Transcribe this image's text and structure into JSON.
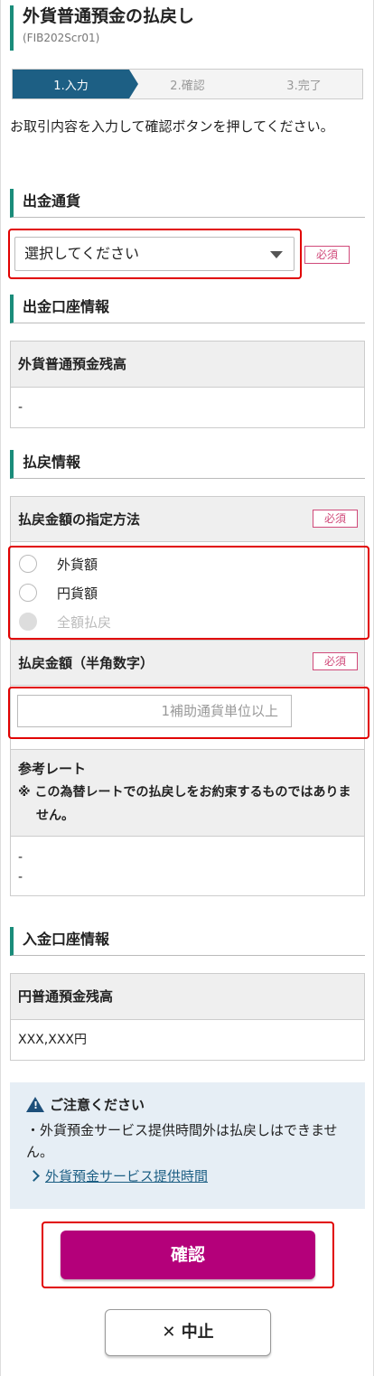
{
  "page": {
    "title": "外貨普通預金の払戻し",
    "screen_id": "(FIB202Scr01)"
  },
  "steps": [
    {
      "label": "1.入力",
      "active": true
    },
    {
      "label": "2.確認",
      "active": false
    },
    {
      "label": "3.完了",
      "active": false
    }
  ],
  "intro": "お取引内容を入力して確認ボタンを押してください。",
  "withdraw_currency": {
    "heading": "出金通貨",
    "select_value": "選択してください",
    "required": "必須"
  },
  "withdraw_account": {
    "heading": "出金口座情報",
    "balance_label": "外貨普通預金残高",
    "balance_value": "-"
  },
  "refund_info": {
    "heading": "払戻情報",
    "method_label": "払戻金額の指定方法",
    "method_required": "必須",
    "options": [
      "外貨額",
      "円貨額",
      "全額払戻"
    ],
    "amount_label": "払戻金額（半角数字）",
    "amount_required": "必須",
    "amount_placeholder": "1補助通貨単位以上",
    "rate_label": "参考レート",
    "rate_note": "※ この為替レートでの払戻しをお約束するものではありません。",
    "rate_value_1": "-",
    "rate_value_2": "-"
  },
  "deposit_account": {
    "heading": "入金口座情報",
    "balance_label": "円普通預金残高",
    "balance_value": "XXX,XXX円"
  },
  "notice": {
    "title": "ご注意ください",
    "body": "・外貨預金サービス提供時間外は払戻しはできません。",
    "link": "外貨預金サービス提供時間"
  },
  "buttons": {
    "confirm": "確認",
    "cancel": "中止"
  },
  "colors": {
    "accent": "#1a8c7a",
    "step_active": "#1d5f84",
    "confirm_button": "#b4007a",
    "highlight": "#e10000"
  }
}
